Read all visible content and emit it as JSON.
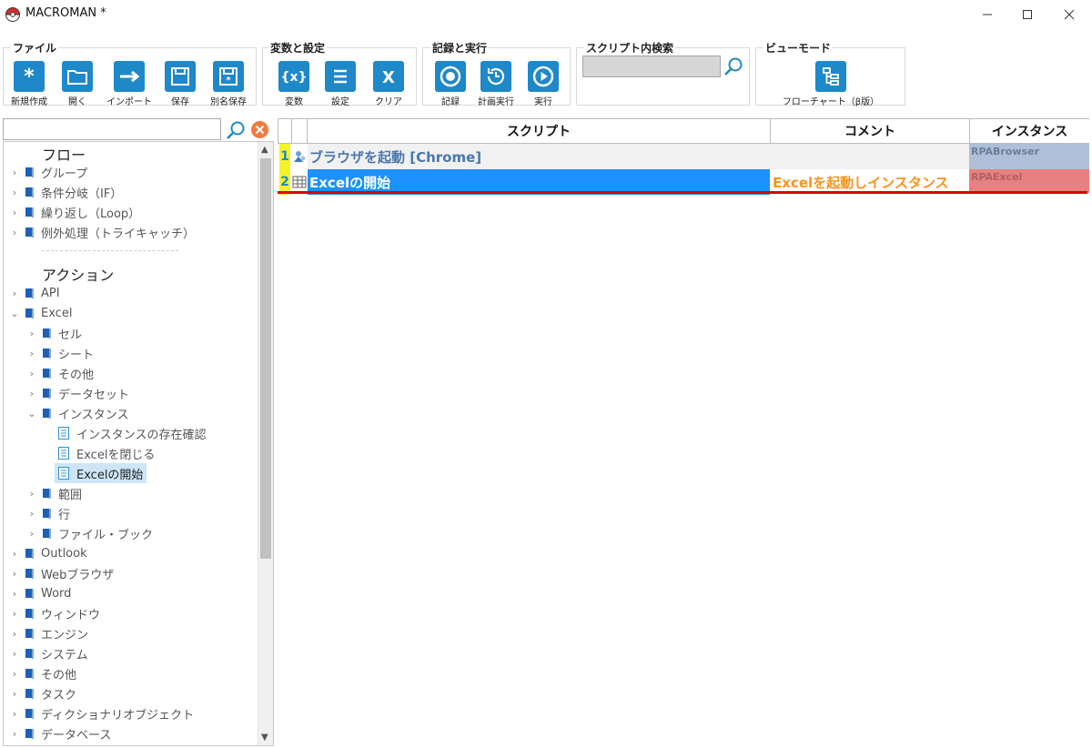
{
  "window": {
    "title": "MACROMAN *"
  },
  "ribbon": {
    "file_group": {
      "label": "ファイル",
      "buttons": [
        {
          "label": "新規作成",
          "icon": "asterisk-icon"
        },
        {
          "label": "開く",
          "icon": "folder-icon"
        },
        {
          "label": "インポート",
          "icon": "arrow-right-icon"
        },
        {
          "label": "保存",
          "icon": "save-icon"
        },
        {
          "label": "別名保存",
          "icon": "save-as-icon"
        }
      ]
    },
    "variables_group": {
      "label": "変数と設定",
      "buttons": [
        {
          "label": "変数",
          "icon": "variable-icon"
        },
        {
          "label": "設定",
          "icon": "list-icon"
        },
        {
          "label": "クリア",
          "icon": "clear-x-icon"
        }
      ]
    },
    "record_group": {
      "label": "記録と実行",
      "buttons": [
        {
          "label": "記録",
          "icon": "record-icon"
        },
        {
          "label": "計画実行",
          "icon": "schedule-icon"
        },
        {
          "label": "実行",
          "icon": "play-icon"
        }
      ]
    },
    "search_group": {
      "label": "スクリプト内検索",
      "value": ""
    },
    "view_group": {
      "label": "ビューモード",
      "button_label": "フローチャート（β版）"
    }
  },
  "left_panel": {
    "search_value": "",
    "flow_heading": "フロー",
    "flow_items": [
      "グループ",
      "条件分岐（IF）",
      "繰り返し（Loop）",
      "例外処理（トライキャッチ）"
    ],
    "action_heading": "アクション",
    "actions": {
      "api": "API",
      "excel": "Excel",
      "excel_children": [
        "セル",
        "シート",
        "その他",
        "データセット",
        "インスタンス"
      ],
      "instance_children": [
        "インスタンスの存在確認",
        "Excelを閉じる",
        "Excelの開始"
      ],
      "excel_children_after": [
        "範囲",
        "行",
        "ファイル・ブック"
      ],
      "rest": [
        "Outlook",
        "Webブラウザ",
        "Word",
        "ウィンドウ",
        "エンジン",
        "システム",
        "その他",
        "タスク",
        "ディクショナリオブジェクト",
        "データベース"
      ]
    }
  },
  "grid": {
    "headers": {
      "script": "スクリプト",
      "comment": "コメント",
      "instance": "インスタンス"
    },
    "rows": [
      {
        "num": "1",
        "script": "ブラウザを起動 [Chrome]",
        "comment": "",
        "instance": "RPABrowser"
      },
      {
        "num": "2",
        "script": "Excelの開始",
        "comment": "Excelを起動しインスタンス",
        "instance": "RPAExcel"
      }
    ]
  },
  "colors": {
    "accent": "#1e88c9",
    "selected_row": "#1e90ff",
    "comment_text": "#f7941d",
    "row1_instance": "#aebfd8",
    "row2_instance": "#e78080",
    "underline": "#e00000",
    "line_number_bg": "#f3f327"
  }
}
